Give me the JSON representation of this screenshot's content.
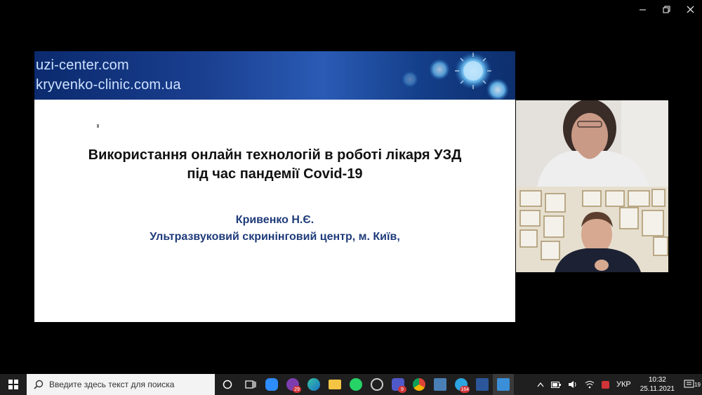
{
  "window": {
    "controls": [
      "minimize",
      "restore",
      "close"
    ]
  },
  "slide": {
    "banner_links": [
      "uzi-center.com",
      "kryvenko-clinic.com.ua"
    ],
    "title_line1": "Використання онлайн технологій в роботі лікаря УЗД",
    "title_line2": "під час пандемії Covid-19",
    "author": "Кривенко Н.Є.",
    "affiliation": "Ультразвуковий скринінговий центр, м. Київ,"
  },
  "participants": [
    {
      "description_icon": "participant-video-woman"
    },
    {
      "description_icon": "participant-video-man"
    }
  ],
  "taskbar": {
    "search_placeholder": "Введите здесь текст для поиска",
    "apps": [
      {
        "icon": "task-view-icon",
        "badge": ""
      },
      {
        "icon": "zoom-icon",
        "badge": ""
      },
      {
        "icon": "viber-icon",
        "badge": "29"
      },
      {
        "icon": "edge-icon",
        "badge": ""
      },
      {
        "icon": "file-explorer-icon",
        "badge": ""
      },
      {
        "icon": "whatsapp-icon",
        "badge": ""
      },
      {
        "icon": "camera-app-icon",
        "badge": ""
      },
      {
        "icon": "teams-icon",
        "badge": "9"
      },
      {
        "icon": "chrome-icon",
        "badge": ""
      },
      {
        "icon": "3d-box-icon",
        "badge": ""
      },
      {
        "icon": "telegram-icon",
        "badge": "164"
      },
      {
        "icon": "word-icon",
        "badge": ""
      },
      {
        "icon": "media-player-icon",
        "badge": ""
      }
    ],
    "language": "УКР",
    "time": "10:32",
    "date": "25.11.2021",
    "notification_count": "19"
  },
  "colors": {
    "banner_dark": "#0b2a6e",
    "banner_mid": "#2a5bb5",
    "author_text": "#1f3b7a",
    "taskbar_bg": "#1f1f1f"
  }
}
